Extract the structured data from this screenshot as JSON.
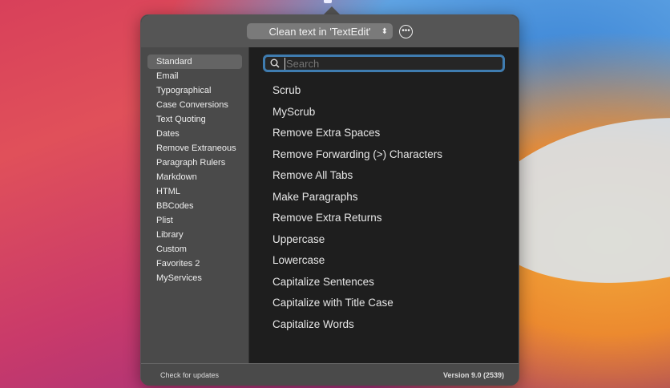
{
  "header": {
    "action_label": "Clean text in 'TextEdit'"
  },
  "sidebar": {
    "items": [
      "Standard",
      "Email",
      "Typographical",
      "Case Conversions",
      "Text Quoting",
      "Dates",
      "Remove Extraneous",
      "Paragraph Rulers",
      "Markdown",
      "HTML",
      "BBCodes",
      "Plist",
      "Library",
      "Custom",
      "Favorites 2",
      "MyServices"
    ],
    "selected": "Standard"
  },
  "search": {
    "placeholder": "Search",
    "value": ""
  },
  "actions": [
    "Scrub",
    "MyScrub",
    "Remove Extra Spaces",
    "Remove Forwarding (>) Characters",
    "Remove All Tabs",
    "Make Paragraphs",
    "Remove Extra Returns",
    "Uppercase",
    "Lowercase",
    "Capitalize Sentences",
    "Capitalize with Title Case",
    "Capitalize Words"
  ],
  "footer": {
    "check_updates": "Check for updates",
    "version": "Version 9.0  (2539)"
  }
}
